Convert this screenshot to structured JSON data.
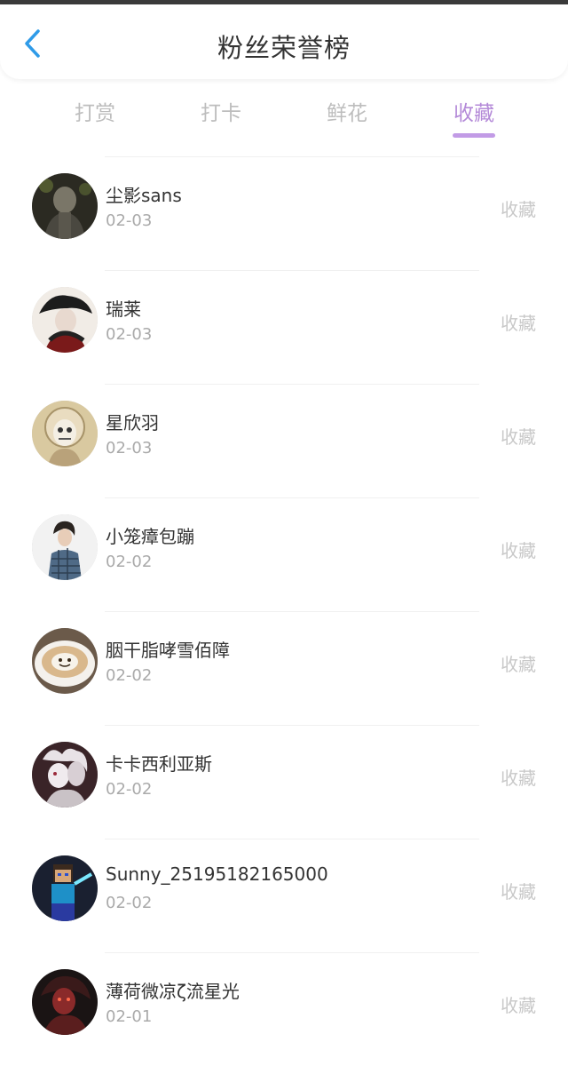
{
  "header": {
    "title": "粉丝荣誉榜"
  },
  "tabs": [
    {
      "label": "打赏",
      "active": false
    },
    {
      "label": "打卡",
      "active": false
    },
    {
      "label": "鲜花",
      "active": false
    },
    {
      "label": "收藏",
      "active": true
    }
  ],
  "colors": {
    "accent": "#b48ad8",
    "text_primary": "#333333",
    "text_secondary": "#aaaaaa",
    "tab_inactive": "#bdbdbd",
    "back_icon": "#2f9be8"
  },
  "fans": [
    {
      "name": "尘影sans",
      "date": "02-03",
      "action": "收藏",
      "avatar_icon": "avatar-dark-character"
    },
    {
      "name": "瑞莱",
      "date": "02-03",
      "action": "收藏",
      "avatar_icon": "avatar-ink-character"
    },
    {
      "name": "星欣羽",
      "date": "02-03",
      "action": "收藏",
      "avatar_icon": "avatar-skull-character"
    },
    {
      "name": "小笼瘴包蹦",
      "date": "02-02",
      "action": "收藏",
      "avatar_icon": "avatar-person-plaid"
    },
    {
      "name": "胭干脂哮雪佰障",
      "date": "02-02",
      "action": "收藏",
      "avatar_icon": "avatar-coffee-cup"
    },
    {
      "name": "卡卡西利亚斯",
      "date": "02-02",
      "action": "收藏",
      "avatar_icon": "avatar-masked-character"
    },
    {
      "name": "Sunny_25195182165000",
      "date": "02-02",
      "action": "收藏",
      "avatar_icon": "avatar-blocky-character"
    },
    {
      "name": "薄荷微凉ζ流星光",
      "date": "02-01",
      "action": "收藏",
      "avatar_icon": "avatar-red-character"
    }
  ]
}
